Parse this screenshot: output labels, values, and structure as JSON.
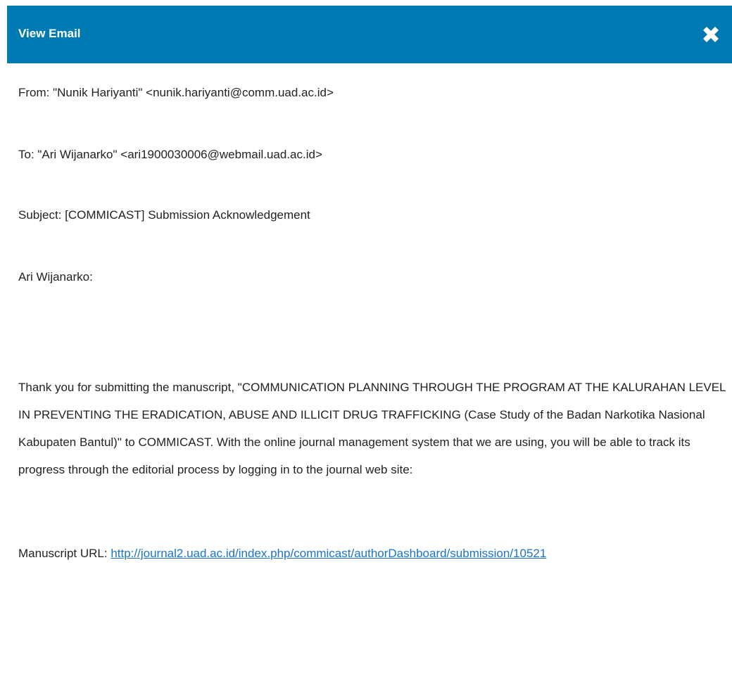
{
  "dialog": {
    "title": "View Email",
    "close_icon": "close-x-icon",
    "header_color": "#007ab2"
  },
  "email": {
    "from": "From: \"Nunik Hariyanti\" <nunik.hariyanti@comm.uad.ac.id>",
    "to": "To: \"Ari Wijanarko\" <ari1900030006@webmail.uad.ac.id>",
    "subject": "Subject: [COMMICAST] Submission Acknowledgement",
    "greeting": "Ari Wijanarko:",
    "body_paragraph": "Thank you for submitting the manuscript, \"COMMUNICATION PLANNING THROUGH THE PROGRAM AT THE KALURAHAN LEVEL IN PREVENTING THE ERADICATION, ABUSE AND ILLICIT DRUG TRAFFICKING (Case Study of the Badan Narkotika Nasional Kabupaten Bantul)\" to COMMICAST. With the online journal management system that we are using, you will be able to track its progress through the editorial process by logging in to the journal web site:",
    "manuscript_url_label": "Manuscript URL: ",
    "manuscript_url": "http://journal2.uad.ac.id/index.php/commicast/authorDashboard/submission/10521",
    "link_color": "#1a73c9"
  }
}
